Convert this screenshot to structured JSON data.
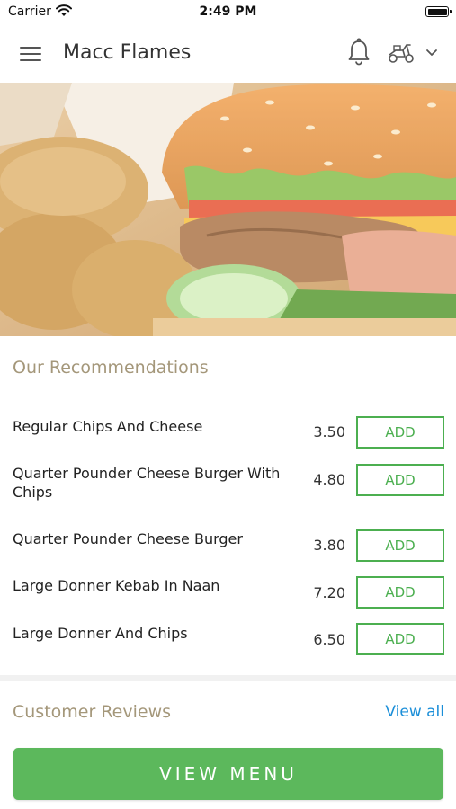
{
  "status_bar": {
    "carrier": "Carrier",
    "time": "2:49 PM"
  },
  "header": {
    "title": "Macc Flames",
    "icons": [
      "menu-icon",
      "bell-icon",
      "scooter-icon",
      "chevron-down-icon"
    ]
  },
  "hero": {
    "image": "burger-and-chicken-nuggets-photo"
  },
  "recommendations": {
    "title": "Our Recommendations",
    "items": [
      {
        "name": "Regular Chips And Cheese",
        "price": "3.50",
        "add_label": "ADD"
      },
      {
        "name": "Quarter Pounder Cheese Burger With Chips",
        "price": "4.80",
        "add_label": "ADD"
      },
      {
        "name": "Quarter Pounder Cheese Burger",
        "price": "3.80",
        "add_label": "ADD"
      },
      {
        "name": "Large Donner Kebab In Naan",
        "price": "7.20",
        "add_label": "ADD"
      },
      {
        "name": "Large Donner And Chips",
        "price": "6.50",
        "add_label": "ADD"
      }
    ]
  },
  "reviews": {
    "title": "Customer Reviews",
    "view_all": "View all"
  },
  "footer": {
    "view_menu": "VIEW MENU"
  },
  "colors": {
    "accent_green": "#4caf50",
    "button_green": "#5cb85c",
    "section_title": "#a4977a",
    "link_blue": "#1a8ed8"
  }
}
